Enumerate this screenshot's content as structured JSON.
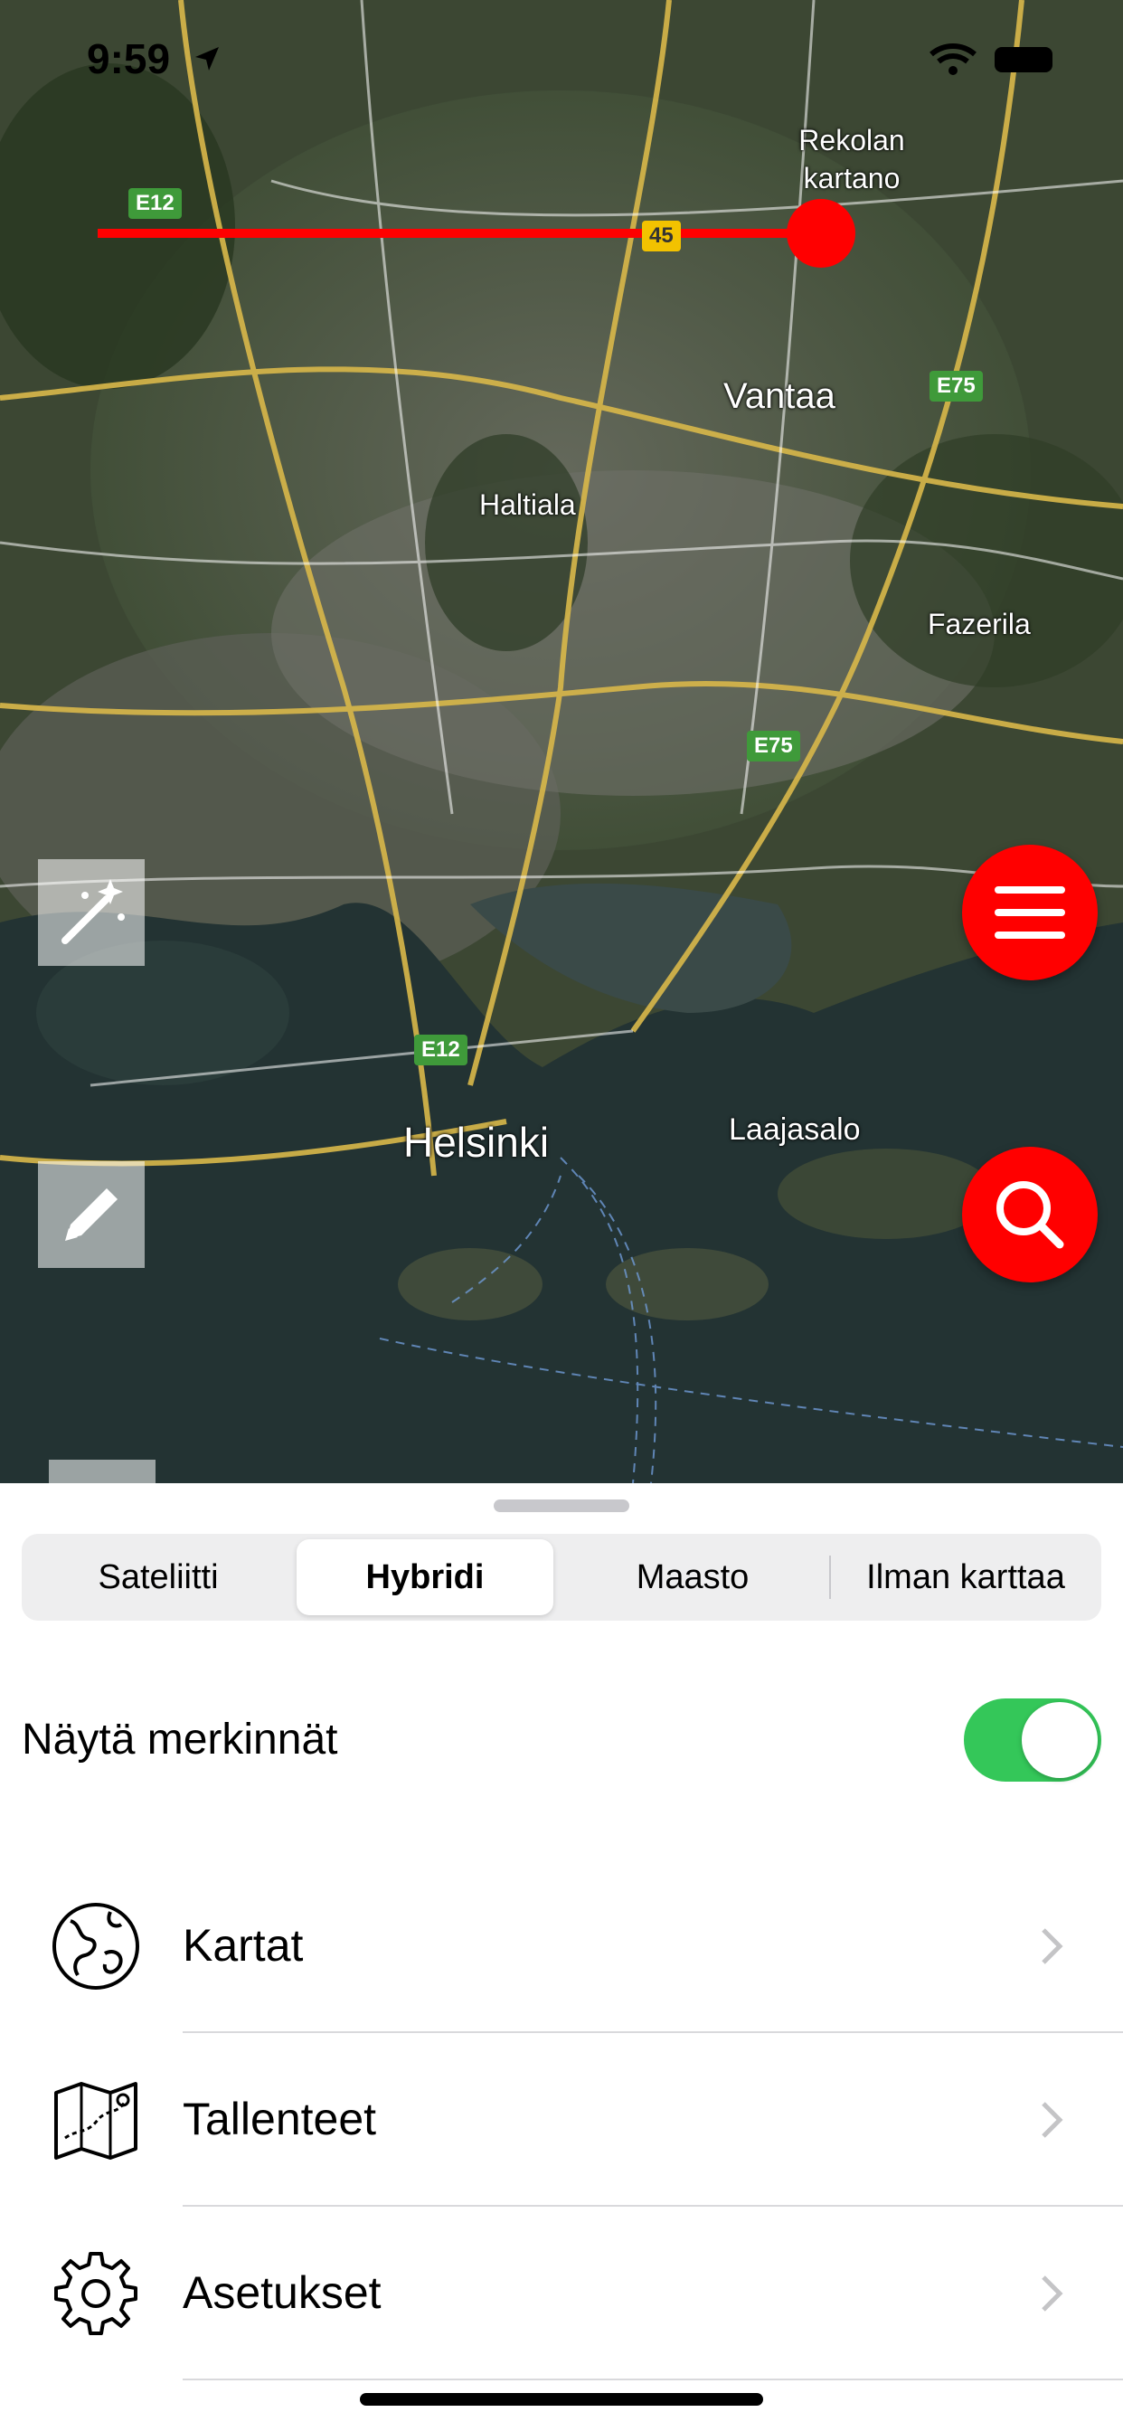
{
  "status_bar": {
    "time": "9:59"
  },
  "map": {
    "labels": {
      "rekolan": "Rekolan\nkartano",
      "vantaa": "Vantaa",
      "haltiala": "Haltiala",
      "fazerila": "Fazerila",
      "helsinki": "Helsinki",
      "laajasalo": "Laajasalo"
    },
    "shields": {
      "e12_top": "E12",
      "r45": "45",
      "e75_top": "E75",
      "e75_mid": "E75",
      "e12_mid": "E12"
    },
    "accent": "#ff0000"
  },
  "sheet": {
    "segments": [
      "Sateliitti",
      "Hybridi",
      "Maasto",
      "Ilman karttaa"
    ],
    "selected_segment": "Hybridi",
    "toggle_label": "Näytä merkinnät",
    "toggle_on": true,
    "menu": [
      {
        "label": "Kartat",
        "icon": "globe-icon"
      },
      {
        "label": "Tallenteet",
        "icon": "map-route-icon"
      },
      {
        "label": "Asetukset",
        "icon": "gear-icon"
      }
    ]
  }
}
